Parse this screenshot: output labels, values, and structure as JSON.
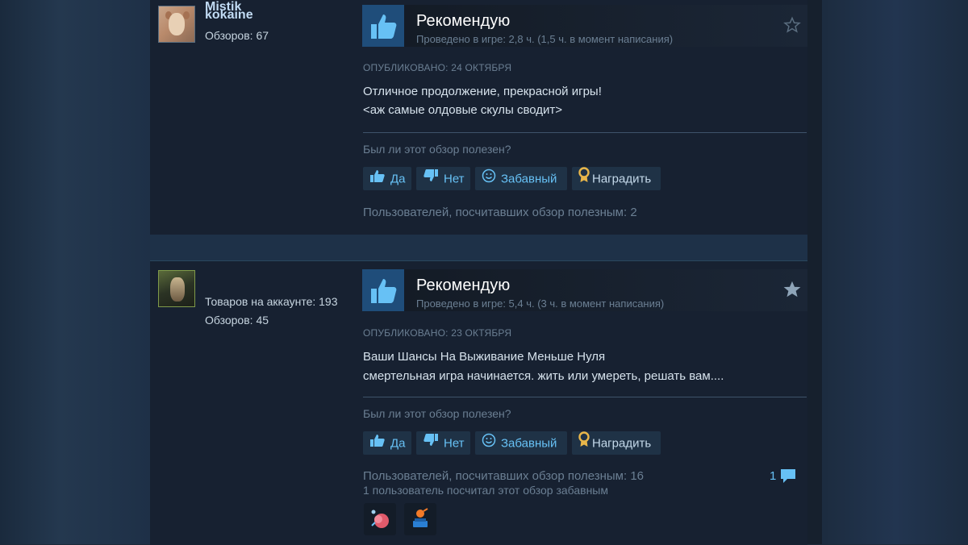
{
  "reviews": [
    {
      "username": "kokaine",
      "stats": [
        "Обзоров: 67"
      ],
      "verdict": "Рекомендую",
      "playtime": "Проведено в игре: 2,8 ч. (1,5 ч. в момент написания)",
      "posted": "ОПУБЛИКОВАНО: 24 ОКТЯБРЯ",
      "body": [
        "Отличное продолжение, прекрасной игры!",
        "<аж самые олдовые скулы сводит>"
      ],
      "helpful_question": "Был ли этот обзор полезен?",
      "buttons": {
        "yes": "Да",
        "no": "Нет",
        "funny": "Забавный",
        "award": "Наградить"
      },
      "found_helpful": "Пользователей, посчитавших обзор полезным: 2",
      "starred": false
    },
    {
      "username": "Mistik",
      "stats": [
        "Товаров на аккаунте: 193",
        "Обзоров: 45"
      ],
      "verdict": "Рекомендую",
      "playtime": "Проведено в игре: 5,4 ч. (3 ч. в момент написания)",
      "posted": "ОПУБЛИКОВАНО: 23 ОКТЯБРЯ",
      "body": [
        "Ваши Шансы На Выживание Меньше Нуля",
        "смертельная игра начинается. жить или умереть, решать вам...."
      ],
      "helpful_question": "Был ли этот обзор полезен?",
      "buttons": {
        "yes": "Да",
        "no": "Нет",
        "funny": "Забавный",
        "award": "Наградить"
      },
      "found_helpful": "Пользователей, посчитавших обзор полезным: 16",
      "found_funny": "1 пользователь посчитал этот обзор забавным",
      "comments": "1",
      "starred": true
    }
  ],
  "colors": {
    "accent": "#67c1f5",
    "panel": "#172131",
    "thumb_bg": "#1f4d7a"
  }
}
